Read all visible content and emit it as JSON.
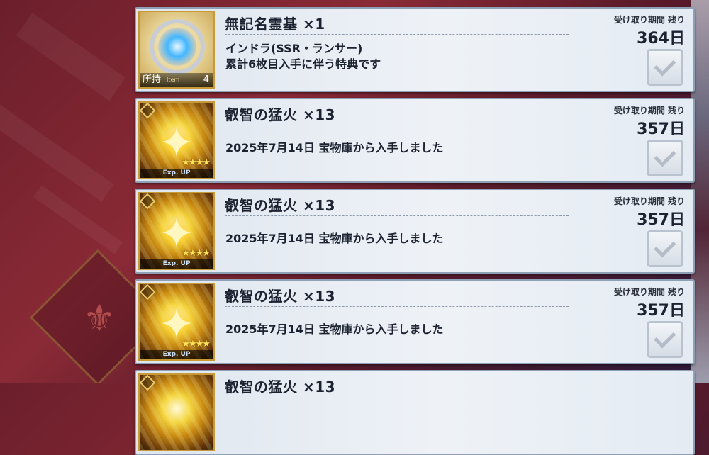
{
  "items": [
    {
      "icon_type": "item",
      "icon_name": "dial-item-icon",
      "owned_label": "所持",
      "owned_sub": "Item",
      "owned_count": "4",
      "name": "無記名霊基 ×1",
      "description": "インドラ(SSR・ランサー)\n累計6枚目入手に伴う特典です",
      "period_label": "受け取り期間 残り",
      "days": "364日"
    },
    {
      "icon_type": "fire",
      "icon_name": "ember-card-icon",
      "stars": "★★★★",
      "exp_label": "Exp. UP",
      "name": "叡智の猛火 ×13",
      "description": "2025年7月14日 宝物庫から入手しました",
      "period_label": "受け取り期間 残り",
      "days": "357日"
    },
    {
      "icon_type": "fire",
      "icon_name": "ember-card-icon",
      "stars": "★★★★",
      "exp_label": "Exp. UP",
      "name": "叡智の猛火 ×13",
      "description": "2025年7月14日 宝物庫から入手しました",
      "period_label": "受け取り期間 残り",
      "days": "357日"
    },
    {
      "icon_type": "fire",
      "icon_name": "ember-card-icon",
      "stars": "★★★★",
      "exp_label": "Exp. UP",
      "name": "叡智の猛火 ×13",
      "description": "2025年7月14日 宝物庫から入手しました",
      "period_label": "受け取り期間 残り",
      "days": "357日"
    },
    {
      "icon_type": "fire",
      "icon_name": "ember-card-icon",
      "name": "叡智の猛火 ×13"
    }
  ]
}
